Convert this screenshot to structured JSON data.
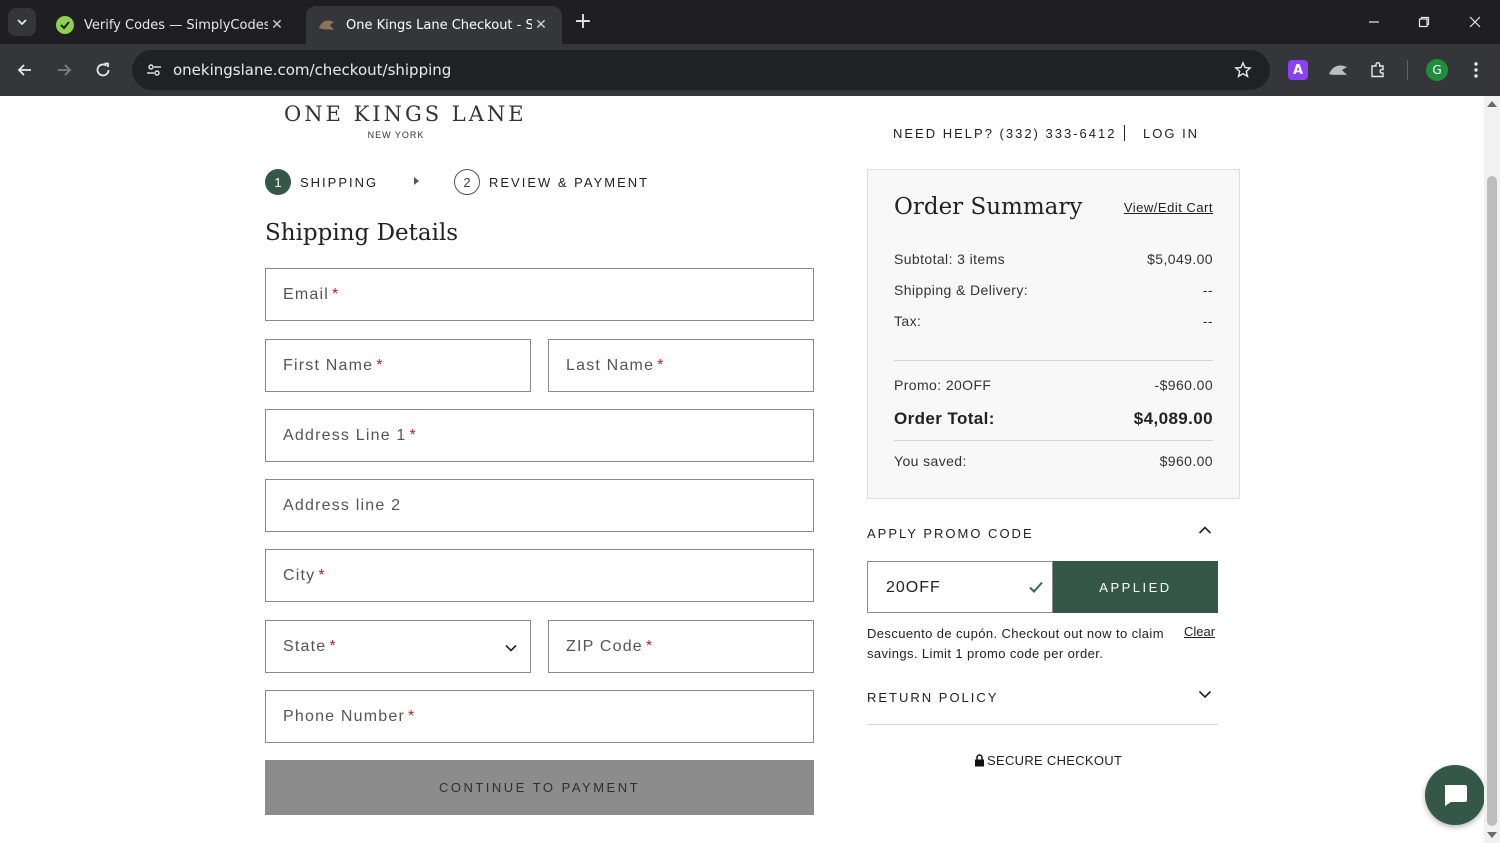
{
  "browser": {
    "tabs": [
      {
        "title": "Verify Codes — SimplyCodes",
        "favicon": "simplycodes-icon"
      },
      {
        "title": "One Kings Lane Checkout - Shipping",
        "favicon": "onekingslane-icon"
      }
    ],
    "url": "onekingslane.com/checkout/shipping",
    "extension_letter": "A",
    "profile_initial": "G"
  },
  "header": {
    "logo_main": "ONE KINGS LANE",
    "logo_sub": "NEW YORK",
    "help": "NEED HELP? (332) 333-6412",
    "login": "LOG IN"
  },
  "steps": [
    {
      "number": "1",
      "label": "SHIPPING",
      "active": true
    },
    {
      "number": "2",
      "label": "REVIEW & PAYMENT",
      "active": false
    }
  ],
  "shipping": {
    "title": "Shipping Details",
    "fields": {
      "email": "Email",
      "first_name": "First Name",
      "last_name": "Last Name",
      "address1": "Address Line 1",
      "address2": "Address line 2",
      "city": "City",
      "state": "State",
      "zip": "ZIP Code",
      "phone": "Phone Number"
    },
    "required_mark": "*",
    "continue_label": "CONTINUE TO PAYMENT"
  },
  "summary": {
    "title": "Order Summary",
    "edit_link": "View/Edit Cart",
    "subtotal_label": "Subtotal: 3 items",
    "subtotal_value": "$5,049.00",
    "shipping_label": "Shipping & Delivery:",
    "shipping_value": "--",
    "tax_label": "Tax:",
    "tax_value": "--",
    "promo_label": "Promo: 20OFF",
    "promo_value": "-$960.00",
    "total_label": "Order Total:",
    "total_value": "$4,089.00",
    "saved_label": "You saved:",
    "saved_value": "$960.00"
  },
  "promo": {
    "heading": "APPLY PROMO CODE",
    "code": "20OFF",
    "button": "APPLIED",
    "message": "Descuento de cupón. Checkout out now to claim savings. Limit 1 promo code per order.",
    "clear": "Clear"
  },
  "return_policy": "RETURN POLICY",
  "secure_checkout": "SECURE CHECKOUT",
  "colors": {
    "brand_green": "#34574a",
    "disabled_button": "#8c8c8c",
    "required": "#b12a2a"
  }
}
